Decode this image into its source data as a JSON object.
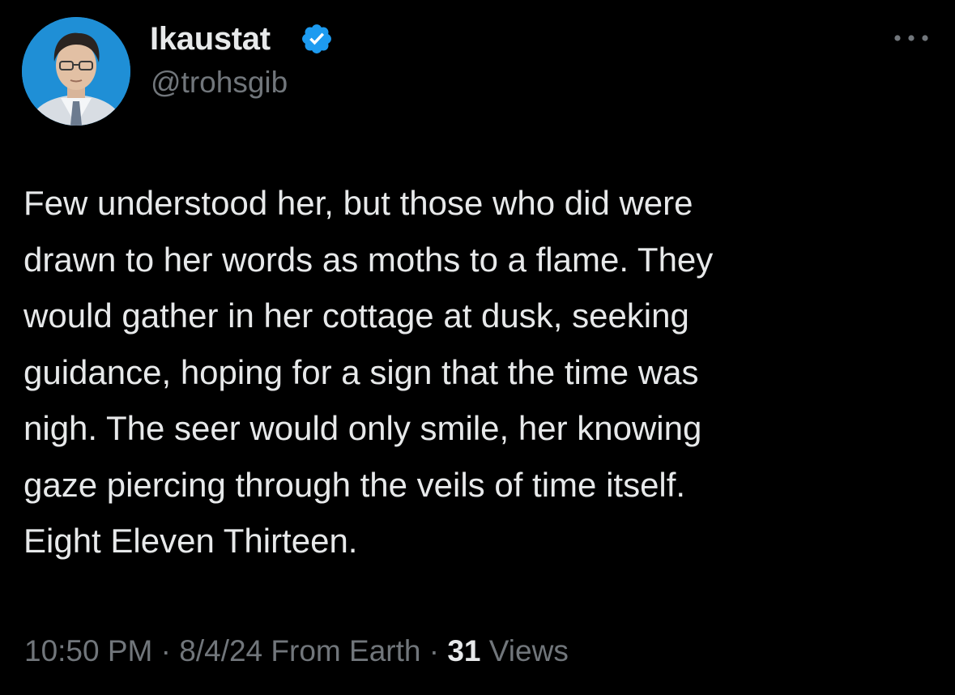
{
  "author": {
    "display_name": "Ikaustat",
    "handle": "@trohsgib",
    "verified": true,
    "verified_color": "#1d9bf0"
  },
  "tweet": {
    "text": "Few understood her, but those who did were\ndrawn to her words as moths to a flame. They\nwould gather in her cottage at dusk, seeking\nguidance, hoping for a sign that the time was\nnigh. The seer would only smile, her knowing\ngaze piercing through the veils of time itself.\nEight Eleven Thirteen."
  },
  "meta": {
    "time": "10:50 PM",
    "separator": " · ",
    "date": "8/4/24",
    "source": "From Earth",
    "views_count": "31",
    "views_label": "Views"
  },
  "icons": {
    "more": "more-horizontal-icon",
    "verified": "verified-badge-icon"
  },
  "colors": {
    "background": "#000000",
    "primary_text": "#e7e9ea",
    "secondary_text": "#71767b",
    "avatar_background": "#1f8fd6"
  }
}
